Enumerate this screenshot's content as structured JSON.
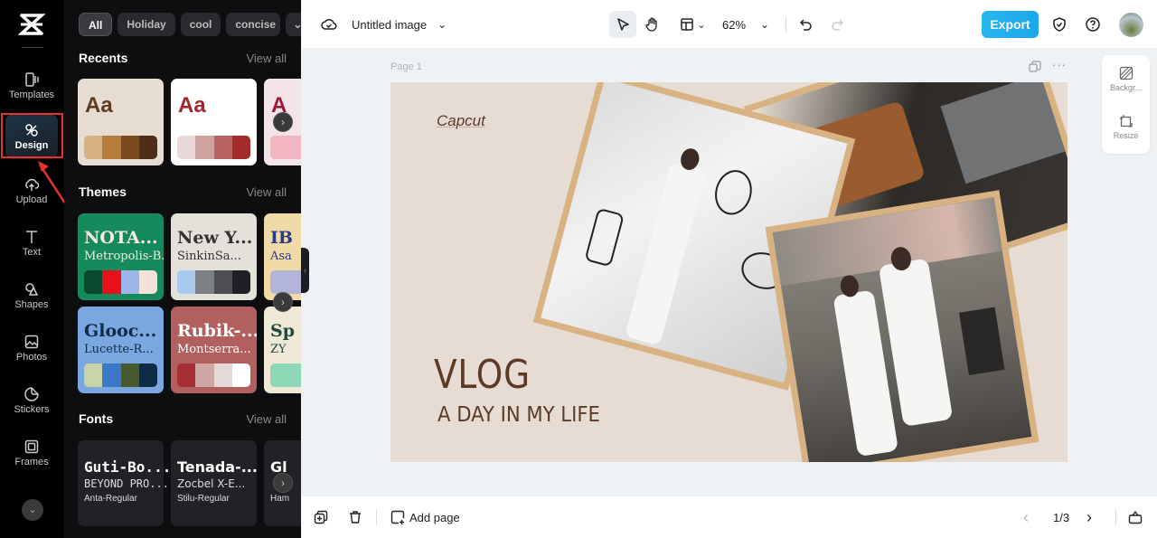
{
  "rail": {
    "logo": "capcut-logo",
    "items": [
      {
        "label": "Templates",
        "icon": "templates-icon"
      },
      {
        "label": "Design",
        "icon": "design-icon",
        "active": true
      },
      {
        "label": "Upload",
        "icon": "upload-icon"
      },
      {
        "label": "Text",
        "icon": "text-icon"
      },
      {
        "label": "Shapes",
        "icon": "shapes-icon"
      },
      {
        "label": "Photos",
        "icon": "photos-icon"
      },
      {
        "label": "Stickers",
        "icon": "stickers-icon"
      },
      {
        "label": "Frames",
        "icon": "frames-icon"
      }
    ],
    "more": "⌄"
  },
  "panel": {
    "chips": [
      "All",
      "Holiday",
      "cool",
      "concise"
    ],
    "chip_more": "⌄",
    "recents": {
      "title": "Recents",
      "view_all": "View all",
      "cards": [
        {
          "label": "Aa",
          "bg": "#e6dcd2",
          "fg": "#5b3b22",
          "colors": [
            "#d7b183",
            "#b77b3e",
            "#7c4a1f",
            "#4e2e17"
          ]
        },
        {
          "label": "Aa",
          "bg": "#ffffff",
          "fg": "#a5252d",
          "colors": [
            "#e8d8d8",
            "#cfa2a2",
            "#b76363",
            "#a52b2b"
          ]
        },
        {
          "label": "A",
          "bg": "#f3e4e7",
          "fg": "#9b1c3a",
          "colors": [
            "#f3b5c1"
          ]
        }
      ]
    },
    "themes": {
      "title": "Themes",
      "view_all": "View all",
      "cards": [
        {
          "title": "NOTA...",
          "subtitle": "Metropolis-B...",
          "bg": "#168a5c",
          "fg": "#f6ebe0",
          "colors": [
            "#0b4a2e",
            "#e8101b",
            "#9db6ea",
            "#f4e3d6"
          ]
        },
        {
          "title": "New Y...",
          "subtitle": "SinkinSa...",
          "bg": "#e4e0da",
          "fg": "#333333",
          "colors": [
            "#a9c8ee",
            "#7c7f83",
            "#4c4e53",
            "#1e2024"
          ]
        },
        {
          "title": "IB",
          "subtitle": "Asa",
          "bg": "#f0dba8",
          "fg": "#2b3885",
          "colors": [
            "#b2b5d9"
          ]
        },
        {
          "title": "Glooc...",
          "subtitle": "Lucette-R...",
          "bg": "#7ba7e0",
          "fg": "#0f2b46",
          "colors": [
            "#c9d3a8",
            "#3979c8",
            "#465a2d",
            "#0e2b45"
          ]
        },
        {
          "title": "Rubik-...",
          "subtitle": "Montserra...",
          "bg": "#b1605f",
          "fg": "#ffffff",
          "colors": [
            "#a72f33",
            "#cea7a5",
            "#e4d9d8",
            "#ffffff"
          ]
        },
        {
          "title": "Sp",
          "subtitle": "ZY",
          "bg": "#efe8d6",
          "fg": "#1f4b3d",
          "colors": [
            "#8fd8b7"
          ]
        }
      ]
    },
    "fonts": {
      "title": "Fonts",
      "view_all": "View all",
      "cards": [
        {
          "line1": "Guti-Bo...",
          "line2": "BEYOND PRO...",
          "line3": "Anta-Regular"
        },
        {
          "line1": "Tenada-...",
          "line2": "Zocbel X-E...",
          "line3": "Stilu-Regular"
        },
        {
          "line1": "Gl",
          "line2": "",
          "line3": "Ham"
        }
      ]
    },
    "next": "›",
    "collapse": "‹"
  },
  "topbar": {
    "cloud_icon": "cloud-check-icon",
    "title": "Untitled image",
    "title_caret": "⌄",
    "zoom": "62%",
    "zoom_caret": "⌄",
    "layout_caret": "⌄",
    "export": "Export"
  },
  "canvas": {
    "page_label": "Page 1",
    "brand": "Capcut",
    "headline": "VLOG",
    "subheadline": "A DAY IN MY LIFE",
    "bg": "#e6dcd3",
    "text_color": "#5b3b27",
    "frame_color": "#d8b283",
    "more": "···"
  },
  "side_tools": [
    {
      "label": "Backgr...",
      "icon": "background-icon"
    },
    {
      "label": "Resize",
      "icon": "resize-icon"
    }
  ],
  "bottombar": {
    "add_page": "Add page",
    "page_indicator": "1/3",
    "prev": "‹",
    "next": "›"
  },
  "annotation": {
    "highlight_color": "#e8332d"
  }
}
